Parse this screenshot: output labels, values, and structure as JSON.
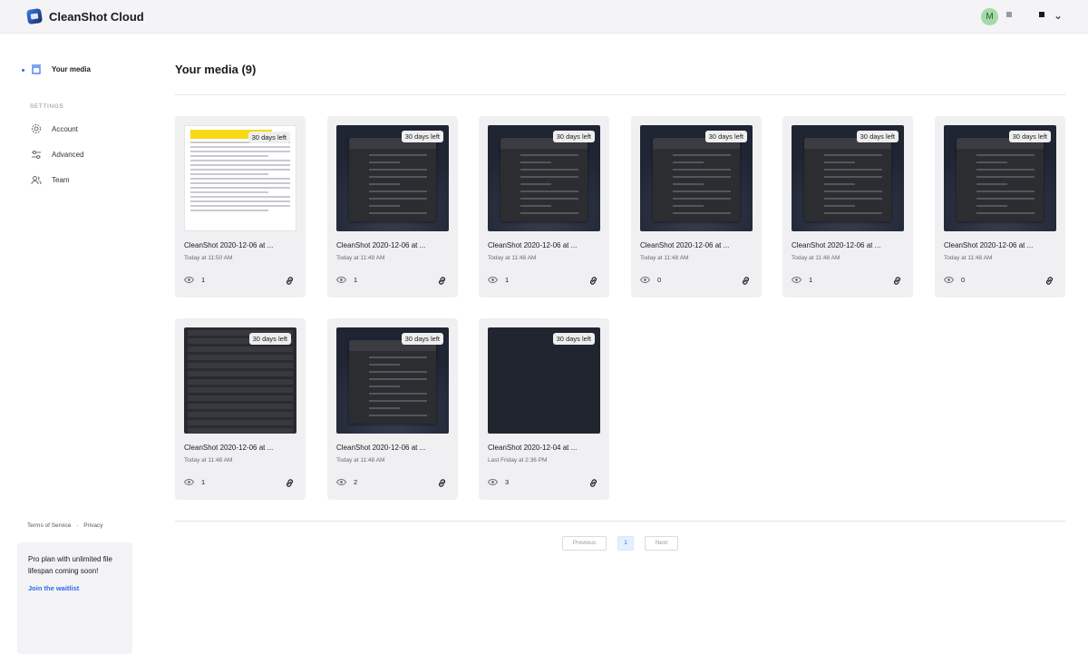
{
  "app": {
    "title": "CleanShot Cloud",
    "avatar_initial": "M"
  },
  "sidebar": {
    "items": [
      {
        "label": "Your media",
        "icon": "media-icon"
      }
    ],
    "settings_heading": "SETTINGS",
    "settings_items": [
      {
        "label": "Account",
        "icon": "gear-icon"
      },
      {
        "label": "Advanced",
        "icon": "sliders-icon"
      },
      {
        "label": "Team",
        "icon": "team-icon"
      }
    ],
    "footer": {
      "terms": "Terms of Service",
      "separator": "·",
      "privacy": "Privacy"
    },
    "promo": {
      "text": "Pro plan with unlimited file lifespan coming soon!",
      "link": "Join the waitlist"
    }
  },
  "main": {
    "title": "Your media (9)",
    "cards": [
      {
        "badge": "30 days left",
        "name": "CleanShot 2020-12-06 at ...",
        "date": "Today at 11:50 AM",
        "views": "1",
        "thumb": "doc"
      },
      {
        "badge": "30 days left",
        "name": "CleanShot 2020-12-06 at ...",
        "date": "Today at 11:49 AM",
        "views": "1",
        "thumb": "desk"
      },
      {
        "badge": "30 days left",
        "name": "CleanShot 2020-12-06 at ...",
        "date": "Today at 11:48 AM",
        "views": "1",
        "thumb": "desk"
      },
      {
        "badge": "30 days left",
        "name": "CleanShot 2020-12-06 at ...",
        "date": "Today at 11:48 AM",
        "views": "0",
        "thumb": "desk"
      },
      {
        "badge": "30 days left",
        "name": "CleanShot 2020-12-06 at ...",
        "date": "Today at 11:48 AM",
        "views": "1",
        "thumb": "desk"
      },
      {
        "badge": "30 days left",
        "name": "CleanShot 2020-12-06 at ...",
        "date": "Today at 11:48 AM",
        "views": "0",
        "thumb": "desk"
      },
      {
        "badge": "30 days left",
        "name": "CleanShot 2020-12-06 at ...",
        "date": "Today at 11:48 AM",
        "views": "1",
        "thumb": "list"
      },
      {
        "badge": "30 days left",
        "name": "CleanShot 2020-12-06 at ...",
        "date": "Today at 11:48 AM",
        "views": "2",
        "thumb": "desk"
      },
      {
        "badge": "30 days left",
        "name": "CleanShot 2020-12-04 at ...",
        "date": "Last Friday at 2:36 PM",
        "views": "3",
        "thumb": "dark"
      }
    ]
  },
  "pagination": {
    "previous": "Previous",
    "current": "1",
    "next": "Next"
  },
  "colors": {
    "accent": "#2f6bf0",
    "card_bg": "#f0f0f2",
    "avatar_bg": "#a6d9a8"
  }
}
